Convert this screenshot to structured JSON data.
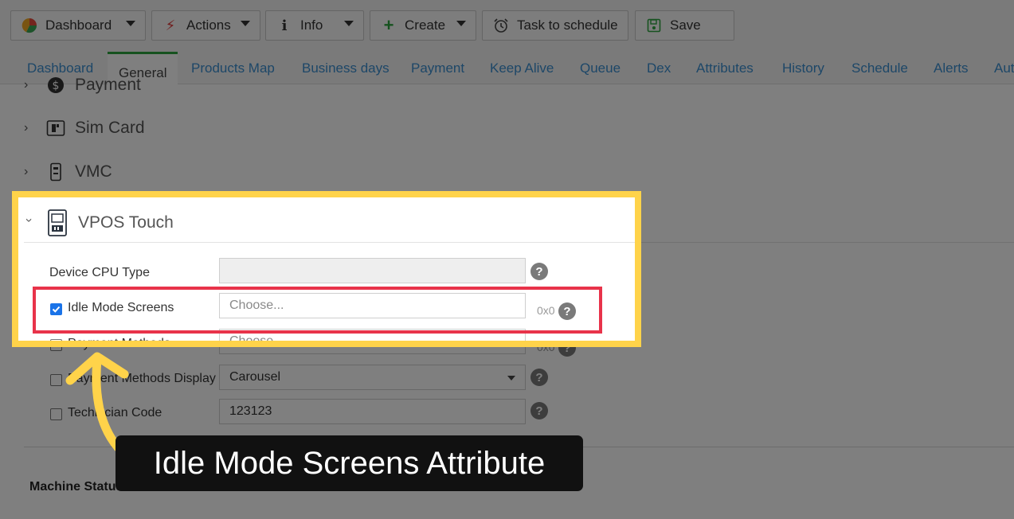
{
  "toolbar": {
    "dashboard_label": "Dashboard",
    "actions_label": "Actions",
    "info_label": "Info",
    "create_label": "Create",
    "task_label": "Task to schedule",
    "save_label": "Save"
  },
  "tabs": [
    {
      "label": "Dashboard"
    },
    {
      "label": "General"
    },
    {
      "label": "Products Map"
    },
    {
      "label": "Business days"
    },
    {
      "label": "Payment"
    },
    {
      "label": "Keep Alive"
    },
    {
      "label": "Queue"
    },
    {
      "label": "Dex"
    },
    {
      "label": "Attributes"
    },
    {
      "label": "History"
    },
    {
      "label": "Schedule"
    },
    {
      "label": "Alerts"
    },
    {
      "label": "Aut"
    }
  ],
  "accordion": {
    "payment": "Payment",
    "sim_card": "Sim Card",
    "vmc": "VMC",
    "vpos_touch": "VPOS Touch"
  },
  "fields": {
    "cpu_type": {
      "label": "Device CPU Type",
      "value": ""
    },
    "idle_mode": {
      "label": "Idle Mode Screens",
      "placeholder": "Choose...",
      "count": "0x0"
    },
    "payment_methods": {
      "label": "Payment Methods",
      "placeholder": "Choose...",
      "count": "0x0"
    },
    "payment_display": {
      "label": "Payment Methods Display",
      "value": "Carousel"
    },
    "technician_code": {
      "label": "Technician Code",
      "value": "123123"
    }
  },
  "section": {
    "machine_status": "Machine Status"
  },
  "annotation": {
    "caption": "Idle Mode Screens Attribute"
  },
  "colors": {
    "highlight": "#ffd34a",
    "focus_box": "#e8334a",
    "tab_accent": "#2ca43f",
    "link": "#3b8ed0"
  }
}
